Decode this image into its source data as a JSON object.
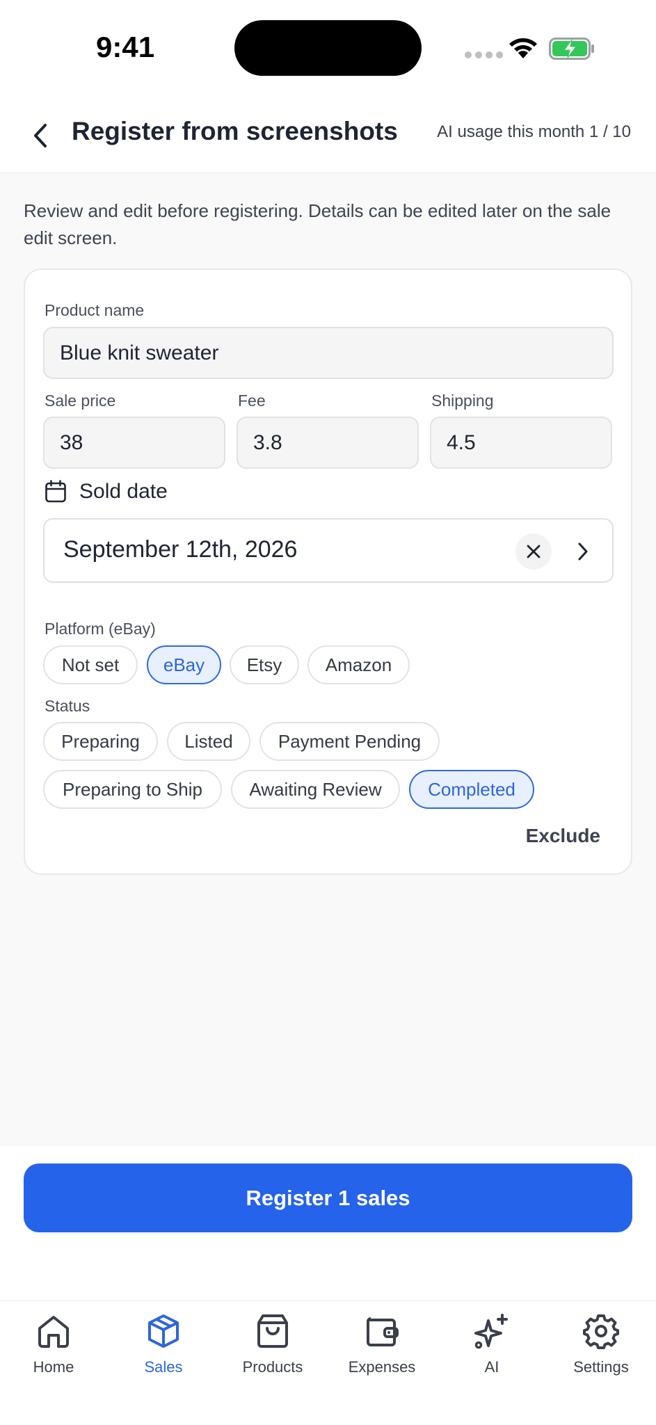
{
  "status_bar": {
    "time": "9:41"
  },
  "header": {
    "title": "Register from screenshots",
    "ai_usage": "AI usage this month 1 / 10"
  },
  "intro_text": "Review and edit before registering. Details can be edited later on the sale edit screen.",
  "form": {
    "product_name_label": "Product name",
    "product_name_value": "Blue knit sweater",
    "sale_price_label": "Sale price",
    "sale_price_value": "38",
    "fee_label": "Fee",
    "fee_value": "3.8",
    "shipping_label": "Shipping",
    "shipping_value": "4.5",
    "sold_date_label": "Sold date",
    "sold_date_value": "September 12th, 2026",
    "platform_label": "Platform (eBay)",
    "platforms": [
      {
        "label": "Not set",
        "selected": false
      },
      {
        "label": "eBay",
        "selected": true
      },
      {
        "label": "Etsy",
        "selected": false
      },
      {
        "label": "Amazon",
        "selected": false
      }
    ],
    "status_label": "Status",
    "statuses": [
      {
        "label": "Preparing",
        "selected": false
      },
      {
        "label": "Listed",
        "selected": false
      },
      {
        "label": "Payment Pending",
        "selected": false
      },
      {
        "label": "Preparing to Ship",
        "selected": false
      },
      {
        "label": "Awaiting Review",
        "selected": false
      },
      {
        "label": "Completed",
        "selected": true
      }
    ],
    "exclude_label": "Exclude"
  },
  "register_button_label": "Register 1 sales",
  "tabs": [
    {
      "label": "Home",
      "icon": "home-icon",
      "active": false
    },
    {
      "label": "Sales",
      "icon": "box-icon",
      "active": true
    },
    {
      "label": "Products",
      "icon": "shopping-bag-icon",
      "active": false
    },
    {
      "label": "Expenses",
      "icon": "wallet-icon",
      "active": false
    },
    {
      "label": "AI",
      "icon": "sparkles-icon",
      "active": false
    },
    {
      "label": "Settings",
      "icon": "gear-icon",
      "active": false
    }
  ],
  "colors": {
    "accent": "#2563eb",
    "chip_selected_bg": "#e9f0fd",
    "battery_green": "#34c759"
  }
}
